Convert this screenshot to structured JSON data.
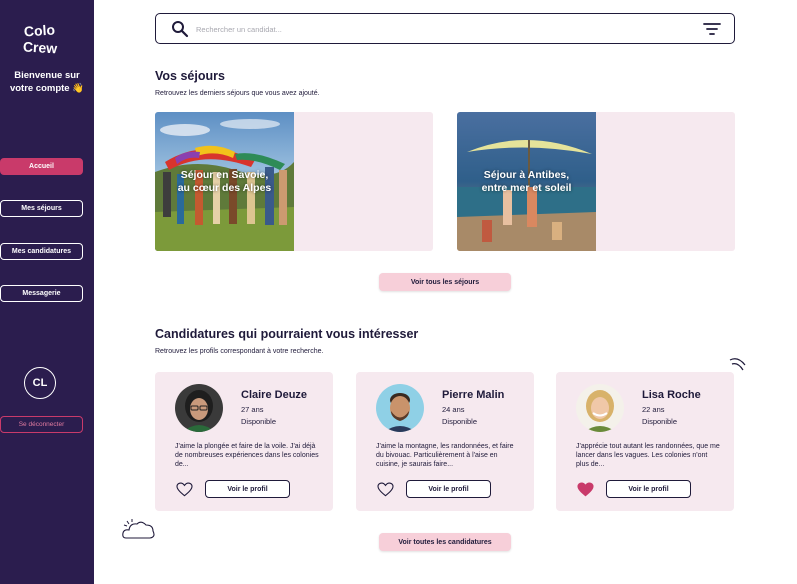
{
  "sidebar": {
    "logo_text": "Colo Crew",
    "welcome_line1": "Bienvenue sur",
    "welcome_line2": "votre compte 👋",
    "nav": [
      {
        "label": "Accueil"
      },
      {
        "label": "Mes séjours"
      },
      {
        "label": "Mes candidatures"
      },
      {
        "label": "Messagerie"
      }
    ],
    "avatar_initials": "CL",
    "logout_label": "Se déconnecter"
  },
  "search": {
    "placeholder": "Rechercher un candidat..."
  },
  "stays": {
    "title": "Vos séjours",
    "subtitle": "Retrouvez les derniers séjours que vous avez ajouté.",
    "items": [
      {
        "title_line1": "Séjour en Savoie,",
        "title_line2": "au cœur des Alpes"
      },
      {
        "title_line1": "Séjour à Antibes,",
        "title_line2": "entre mer et soleil"
      }
    ],
    "see_all_label": "Voir tous les séjours"
  },
  "candidates": {
    "title": "Candidatures qui pourraient vous intéresser",
    "subtitle": "Retrouvez les profils correspondant à votre recherche.",
    "items": [
      {
        "name": "Claire Deuze",
        "age": "27 ans",
        "status": "Disponible",
        "desc": "J'aime la plongée et faire de la voile. J'ai déjà de nombreuses expériences dans les colonies de...",
        "liked": false
      },
      {
        "name": "Pierre Malin",
        "age": "24 ans",
        "status": "Disponible",
        "desc": "J'aime la montagne, les randonnées, et faire du bivouac. Particulièrement à l'aise en cuisine, je saurais faire...",
        "liked": false
      },
      {
        "name": "Lisa Roche",
        "age": "22 ans",
        "status": "Disponible",
        "desc": "J'apprécie tout autant les randonnées, que me lancer dans les vagues. Les colonies n'ont plus de...",
        "liked": true
      }
    ],
    "profile_label": "Voir le profil",
    "see_all_label": "Voir toutes les candidatures"
  },
  "colors": {
    "sidebar": "#2b1d4e",
    "accent": "#c93a6a",
    "card": "#f6e9ef",
    "button_pink": "#f7cfd9"
  }
}
